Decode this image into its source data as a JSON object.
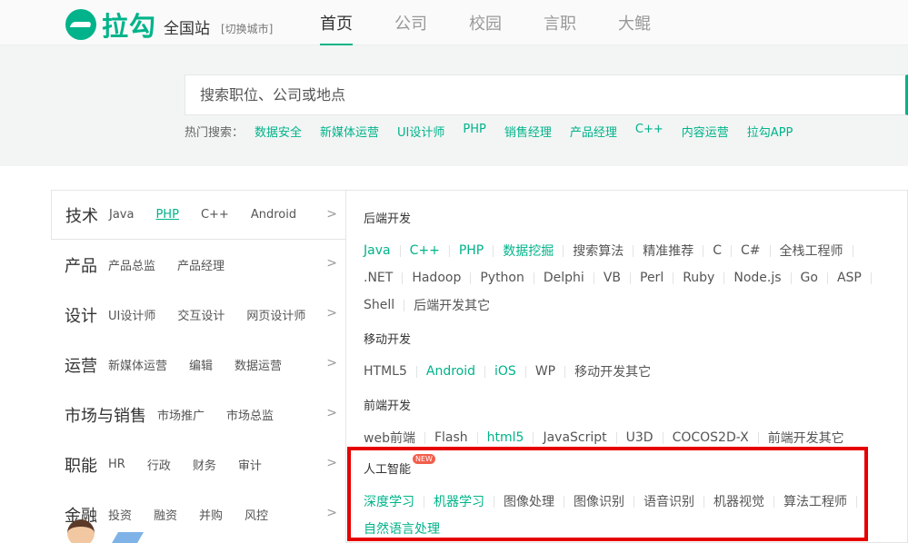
{
  "header": {
    "logo_text": "拉勾",
    "city": "全国站",
    "city_switch": "[切换城市]",
    "nav": [
      {
        "label": "首页",
        "active": true
      },
      {
        "label": "公司",
        "active": false
      },
      {
        "label": "校园",
        "active": false
      },
      {
        "label": "言职",
        "active": false
      },
      {
        "label": "大鲲",
        "active": false
      }
    ]
  },
  "search": {
    "placeholder": "搜索职位、公司或地点",
    "hot_label": "热门搜索：",
    "hot_links": [
      "数据安全",
      "新媒体运营",
      "UI设计师",
      "PHP",
      "销售经理",
      "产品经理",
      "C++",
      "内容运营",
      "拉勾APP"
    ]
  },
  "menu": [
    {
      "category": "技术",
      "subs": [
        "Java",
        "PHP",
        "C++",
        "Android"
      ],
      "highlight": "PHP",
      "active": true
    },
    {
      "category": "产品",
      "subs": [
        "产品总监",
        "产品经理"
      ]
    },
    {
      "category": "设计",
      "subs": [
        "UI设计师",
        "交互设计",
        "网页设计师"
      ]
    },
    {
      "category": "运营",
      "subs": [
        "新媒体运营",
        "编辑",
        "数据运营"
      ]
    },
    {
      "category": "市场与销售",
      "subs": [
        "市场推广",
        "市场总监"
      ]
    },
    {
      "category": "职能",
      "subs": [
        "HR",
        "行政",
        "财务",
        "审计"
      ]
    },
    {
      "category": "金融",
      "subs": [
        "投资",
        "融资",
        "并购",
        "风控"
      ]
    }
  ],
  "panel": {
    "backend": {
      "title": "后端开发",
      "tags": [
        {
          "t": "Java",
          "g": true
        },
        {
          "t": "C++",
          "g": true
        },
        {
          "t": "PHP",
          "g": true
        },
        {
          "t": "数据挖掘",
          "g": true
        },
        {
          "t": "搜索算法"
        },
        {
          "t": "精准推荐"
        },
        {
          "t": "C"
        },
        {
          "t": "C#"
        },
        {
          "t": "全栈工程师"
        },
        {
          "t": ".NET"
        },
        {
          "t": "Hadoop"
        },
        {
          "t": "Python"
        },
        {
          "t": "Delphi"
        },
        {
          "t": "VB"
        },
        {
          "t": "Perl"
        },
        {
          "t": "Ruby"
        },
        {
          "t": "Node.js"
        },
        {
          "t": "Go"
        },
        {
          "t": "ASP"
        },
        {
          "t": "Shell"
        },
        {
          "t": "后端开发其它"
        }
      ]
    },
    "mobile": {
      "title": "移动开发",
      "tags": [
        {
          "t": "HTML5"
        },
        {
          "t": "Android",
          "g": true
        },
        {
          "t": "iOS",
          "g": true
        },
        {
          "t": "WP"
        },
        {
          "t": "移动开发其它"
        }
      ]
    },
    "frontend": {
      "title": "前端开发",
      "tags": [
        {
          "t": "web前端"
        },
        {
          "t": "Flash"
        },
        {
          "t": "html5",
          "g": true
        },
        {
          "t": "JavaScript"
        },
        {
          "t": "U3D"
        },
        {
          "t": "COCOS2D-X"
        },
        {
          "t": "前端开发其它"
        }
      ]
    },
    "ai": {
      "title": "人工智能",
      "badge": "NEW",
      "tags": [
        {
          "t": "深度学习",
          "g": true
        },
        {
          "t": "机器学习",
          "g": true
        },
        {
          "t": "图像处理"
        },
        {
          "t": "图像识别"
        },
        {
          "t": "语音识别"
        },
        {
          "t": "机器视觉"
        },
        {
          "t": "算法工程师"
        },
        {
          "t": "自然语言处理",
          "g": true
        }
      ]
    }
  },
  "colors": {
    "accent": "#00b38a",
    "highlight_box": "#e60000",
    "badge": "#f25e4c"
  }
}
